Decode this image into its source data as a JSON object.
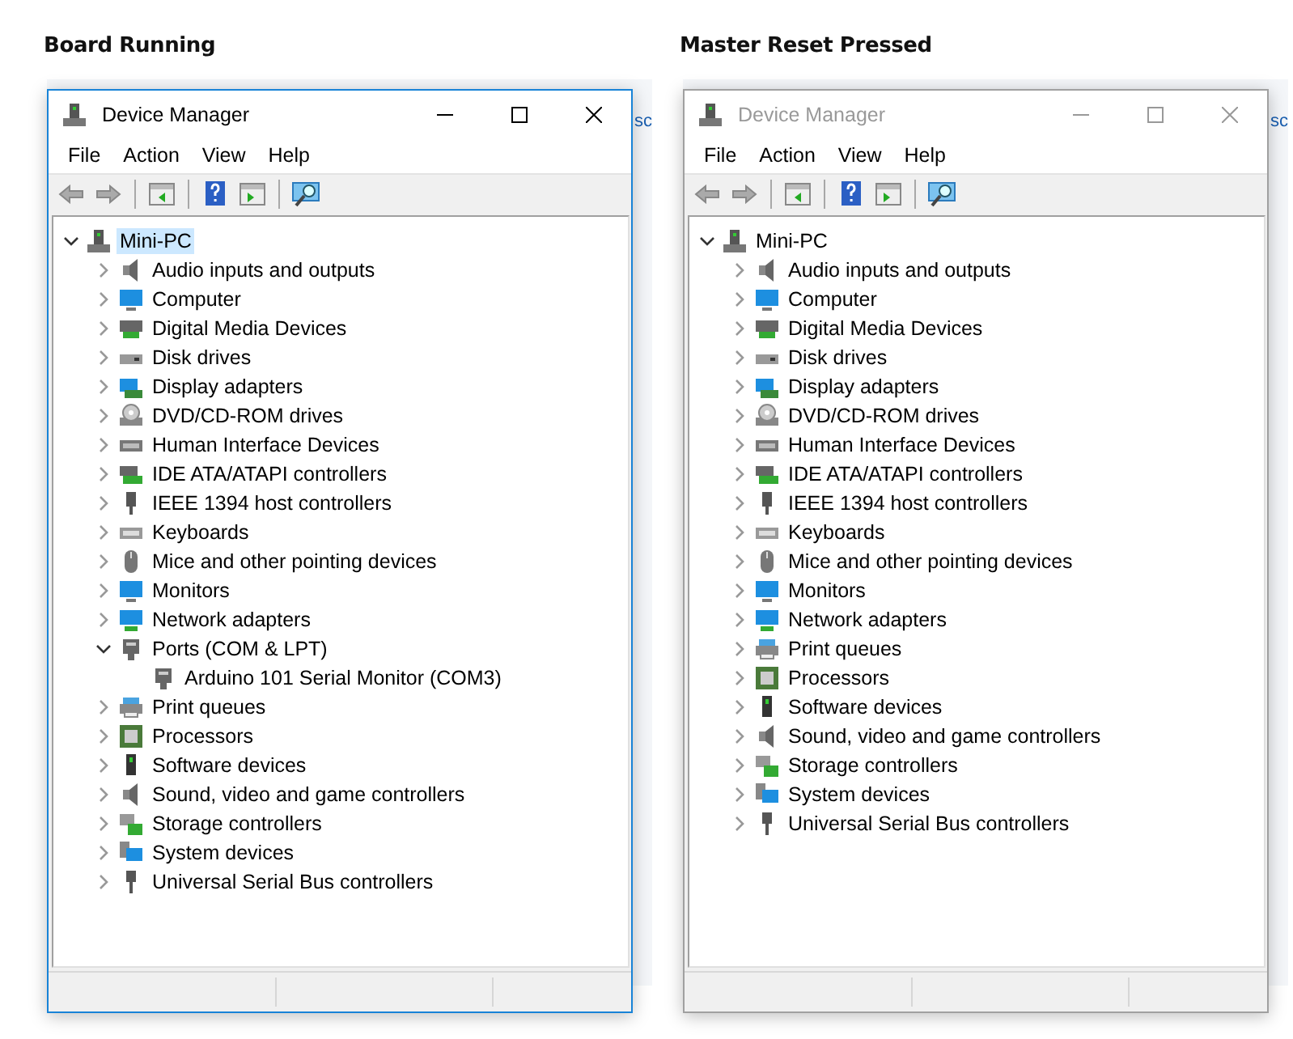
{
  "panels": [
    {
      "heading": "Board Running",
      "backdrop_text": "sc",
      "window": {
        "title": "Device Manager",
        "active": true,
        "menu": [
          "File",
          "Action",
          "View",
          "Help"
        ],
        "tree": {
          "label": "Mini-PC",
          "kind": "pc",
          "expanded": true,
          "selected": true,
          "children": [
            {
              "label": "Audio inputs and outputs",
              "kind": "audio",
              "expanded": false
            },
            {
              "label": "Computer",
              "kind": "monitor",
              "expanded": false
            },
            {
              "label": "Digital Media Devices",
              "kind": "media",
              "expanded": false
            },
            {
              "label": "Disk drives",
              "kind": "disk",
              "expanded": false
            },
            {
              "label": "Display adapters",
              "kind": "display",
              "expanded": false
            },
            {
              "label": "DVD/CD-ROM drives",
              "kind": "dvd",
              "expanded": false
            },
            {
              "label": "Human Interface Devices",
              "kind": "hid",
              "expanded": false
            },
            {
              "label": "IDE ATA/ATAPI controllers",
              "kind": "ide",
              "expanded": false
            },
            {
              "label": "IEEE 1394 host controllers",
              "kind": "plug",
              "expanded": false
            },
            {
              "label": "Keyboards",
              "kind": "keyboard",
              "expanded": false
            },
            {
              "label": "Mice and other pointing devices",
              "kind": "mouse",
              "expanded": false
            },
            {
              "label": "Monitors",
              "kind": "monitor",
              "expanded": false
            },
            {
              "label": "Network adapters",
              "kind": "network",
              "expanded": false
            },
            {
              "label": "Ports (COM & LPT)",
              "kind": "port",
              "expanded": true,
              "children": [
                {
                  "label": "Arduino 101 Serial Monitor (COM3)",
                  "kind": "port"
                }
              ]
            },
            {
              "label": "Print queues",
              "kind": "printer",
              "expanded": false
            },
            {
              "label": "Processors",
              "kind": "cpu",
              "expanded": false
            },
            {
              "label": "Software devices",
              "kind": "software",
              "expanded": false
            },
            {
              "label": "Sound, video and game controllers",
              "kind": "audio",
              "expanded": false
            },
            {
              "label": "Storage controllers",
              "kind": "storage",
              "expanded": false
            },
            {
              "label": "System devices",
              "kind": "system",
              "expanded": false
            },
            {
              "label": "Universal Serial Bus controllers",
              "kind": "usb",
              "expanded": false
            }
          ]
        }
      }
    },
    {
      "heading": "Master Reset Pressed",
      "backdrop_text": "sc",
      "window": {
        "title": "Device Manager",
        "active": false,
        "menu": [
          "File",
          "Action",
          "View",
          "Help"
        ],
        "tree": {
          "label": "Mini-PC",
          "kind": "pc",
          "expanded": true,
          "selected": false,
          "children": [
            {
              "label": "Audio inputs and outputs",
              "kind": "audio",
              "expanded": false
            },
            {
              "label": "Computer",
              "kind": "monitor",
              "expanded": false
            },
            {
              "label": "Digital Media Devices",
              "kind": "media",
              "expanded": false
            },
            {
              "label": "Disk drives",
              "kind": "disk",
              "expanded": false
            },
            {
              "label": "Display adapters",
              "kind": "display",
              "expanded": false
            },
            {
              "label": "DVD/CD-ROM drives",
              "kind": "dvd",
              "expanded": false
            },
            {
              "label": "Human Interface Devices",
              "kind": "hid",
              "expanded": false
            },
            {
              "label": "IDE ATA/ATAPI controllers",
              "kind": "ide",
              "expanded": false
            },
            {
              "label": "IEEE 1394 host controllers",
              "kind": "plug",
              "expanded": false
            },
            {
              "label": "Keyboards",
              "kind": "keyboard",
              "expanded": false
            },
            {
              "label": "Mice and other pointing devices",
              "kind": "mouse",
              "expanded": false
            },
            {
              "label": "Monitors",
              "kind": "monitor",
              "expanded": false
            },
            {
              "label": "Network adapters",
              "kind": "network",
              "expanded": false
            },
            {
              "label": "Print queues",
              "kind": "printer",
              "expanded": false
            },
            {
              "label": "Processors",
              "kind": "cpu",
              "expanded": false
            },
            {
              "label": "Software devices",
              "kind": "software",
              "expanded": false
            },
            {
              "label": "Sound, video and game controllers",
              "kind": "audio",
              "expanded": false
            },
            {
              "label": "Storage controllers",
              "kind": "storage",
              "expanded": false
            },
            {
              "label": "System devices",
              "kind": "system",
              "expanded": false
            },
            {
              "label": "Universal Serial Bus controllers",
              "kind": "usb",
              "expanded": false
            }
          ]
        }
      }
    }
  ]
}
